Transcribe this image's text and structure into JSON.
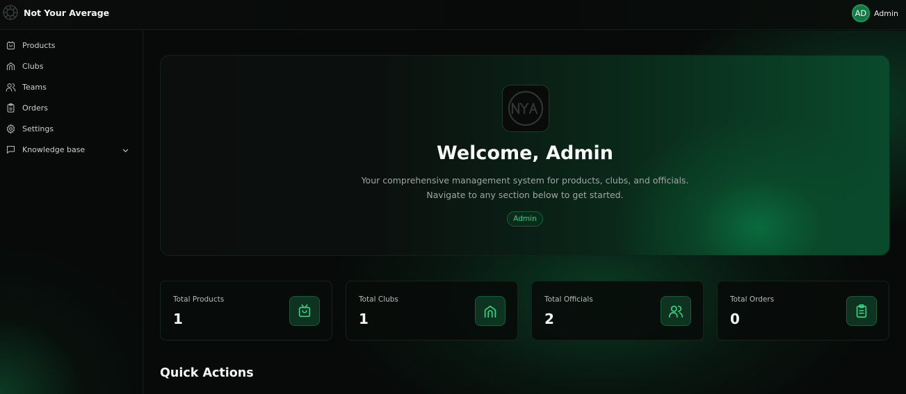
{
  "app": {
    "title": "Not Your Average"
  },
  "user": {
    "initials": "AD",
    "name": "Admin"
  },
  "sidebar": {
    "items": [
      {
        "label": "Products",
        "icon": "shopping-bag-icon"
      },
      {
        "label": "Clubs",
        "icon": "building-icon"
      },
      {
        "label": "Teams",
        "icon": "users-icon"
      },
      {
        "label": "Orders",
        "icon": "clipboard-icon"
      },
      {
        "label": "Settings",
        "icon": "gear-icon"
      },
      {
        "label": "Knowledge base",
        "icon": "message-square-icon",
        "expandable": true
      }
    ]
  },
  "hero": {
    "title": "Welcome, Admin",
    "subtitle_line1": "Your comprehensive management system for products, clubs, and officials.",
    "subtitle_line2": "Navigate to any section below to get started.",
    "role_badge": "Admin"
  },
  "stats": [
    {
      "title": "Total Products",
      "value": "1",
      "icon": "shopping-bag-icon"
    },
    {
      "title": "Total Clubs",
      "value": "1",
      "icon": "building-icon"
    },
    {
      "title": "Total Officials",
      "value": "2",
      "icon": "users-icon"
    },
    {
      "title": "Total Orders",
      "value": "0",
      "icon": "clipboard-icon"
    }
  ],
  "quick_actions": {
    "title": "Quick Actions"
  },
  "colors": {
    "accent": "#27d07a",
    "background": "#070a09",
    "card": "#0a0e0c",
    "icon_tile": "#0e3321"
  }
}
